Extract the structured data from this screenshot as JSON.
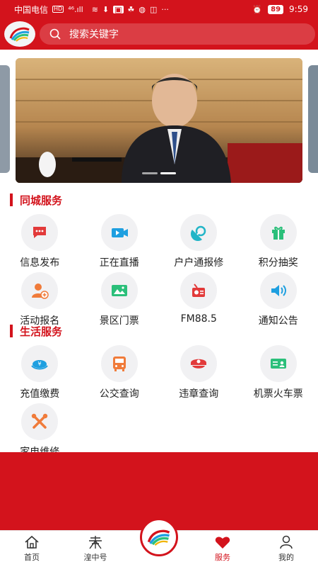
{
  "status_bar": {
    "carrier": "中国电信",
    "hd": "HD",
    "signal": "⁴⁶.ıll",
    "battery": "89",
    "time": "9:59"
  },
  "search": {
    "placeholder": "搜索关键字"
  },
  "carousel": {
    "slide_count": 2,
    "active_index": 1
  },
  "sections": {
    "city_services": {
      "title": "同城服务",
      "items": [
        {
          "label": "信息发布",
          "icon": "message-icon",
          "color": "#e23a3a"
        },
        {
          "label": "正在直播",
          "icon": "live-video-icon",
          "color": "#1e9fe0"
        },
        {
          "label": "户户通报修",
          "icon": "satellite-repair-icon",
          "color": "#22b5c7"
        },
        {
          "label": "积分抽奖",
          "icon": "gift-icon",
          "color": "#2bbf7a"
        },
        {
          "label": "活动报名",
          "icon": "user-add-icon",
          "color": "#f07b3a"
        },
        {
          "label": "景区门票",
          "icon": "ticket-icon",
          "color": "#2bbf7a"
        },
        {
          "label": "FM88.5",
          "icon": "radio-icon",
          "color": "#e23a3a"
        },
        {
          "label": "通知公告",
          "icon": "speaker-icon",
          "color": "#1e9fe0"
        }
      ]
    },
    "life_services": {
      "title": "生活服务",
      "items": [
        {
          "label": "充值缴费",
          "icon": "payment-icon",
          "color": "#1e9fe0"
        },
        {
          "label": "公交查询",
          "icon": "bus-icon",
          "color": "#f07b3a"
        },
        {
          "label": "违章查询",
          "icon": "police-cap-icon",
          "color": "#e23a3a"
        },
        {
          "label": "机票火车票",
          "icon": "id-card-icon",
          "color": "#2bbf7a"
        },
        {
          "label": "家电维修",
          "icon": "tools-icon",
          "color": "#f07b3a"
        }
      ]
    }
  },
  "bottom_nav": [
    {
      "label": "首页",
      "icon": "home-icon"
    },
    {
      "label": "湟中号",
      "icon": "tower-icon"
    },
    {
      "label": "",
      "icon": "app-logo-icon"
    },
    {
      "label": "服务",
      "icon": "heart-icon",
      "active": true
    },
    {
      "label": "我的",
      "icon": "user-icon"
    }
  ],
  "colors": {
    "brand_red": "#d3131c"
  }
}
